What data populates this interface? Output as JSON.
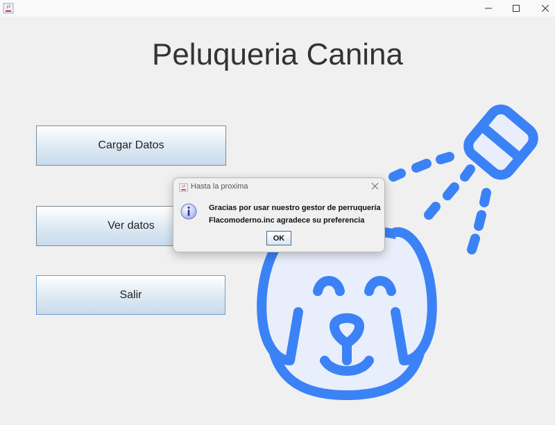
{
  "window": {
    "title": ""
  },
  "app": {
    "title": "Peluqueria Canina",
    "buttons": {
      "cargar": "Cargar Datos",
      "ver": "Ver datos",
      "salir": "Salir"
    },
    "illustration": "dog-shower-icon",
    "accent_color": "#3b82f6"
  },
  "dialog": {
    "title": "Hasta la proxima",
    "line1": "Gracias por usar nuestro gestor de perruquería",
    "line2": "Flacomoderno.inc agradece su preferencia",
    "ok_label": "OK",
    "icon": "info-icon"
  }
}
